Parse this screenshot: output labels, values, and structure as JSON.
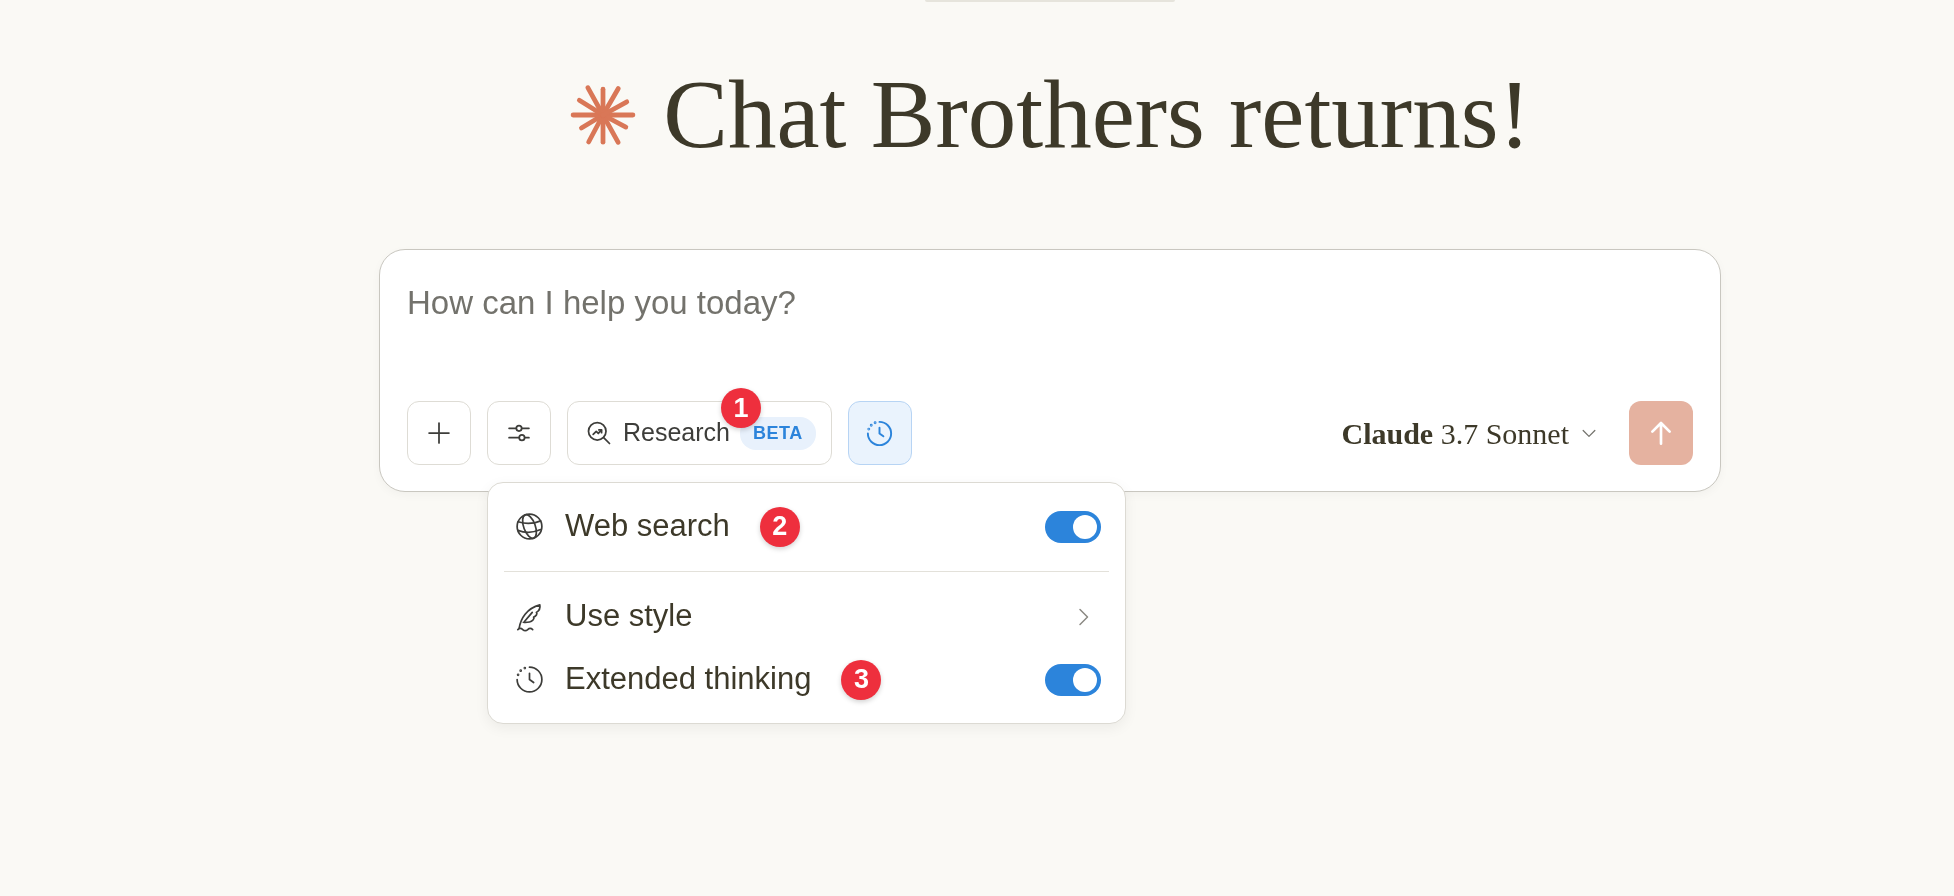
{
  "heading": {
    "title": "Chat Brothers returns!"
  },
  "composer": {
    "placeholder": "How can I help you today?",
    "tools": [
      {
        "kind": "add",
        "active": false
      },
      {
        "kind": "options",
        "active": false
      },
      {
        "kind": "research",
        "label": "Research",
        "badge": "BETA",
        "active": false,
        "marker": "1"
      },
      {
        "kind": "thinking",
        "active": true
      }
    ],
    "model": {
      "label": "**Claude** 3.7 Sonnet"
    },
    "send_button": {
      "disabled": true
    }
  },
  "menu": {
    "sections": [
      {
        "items": [
          {
            "kind": "search",
            "label": "Web search",
            "on": true,
            "marker": "2"
          }
        ]
      },
      {
        "items": [
          {
            "kind": "style",
            "label": "Use style"
          },
          {
            "kind": "thinking",
            "label": "Extended thinking",
            "on": true,
            "marker": "3"
          }
        ]
      }
    ]
  }
}
